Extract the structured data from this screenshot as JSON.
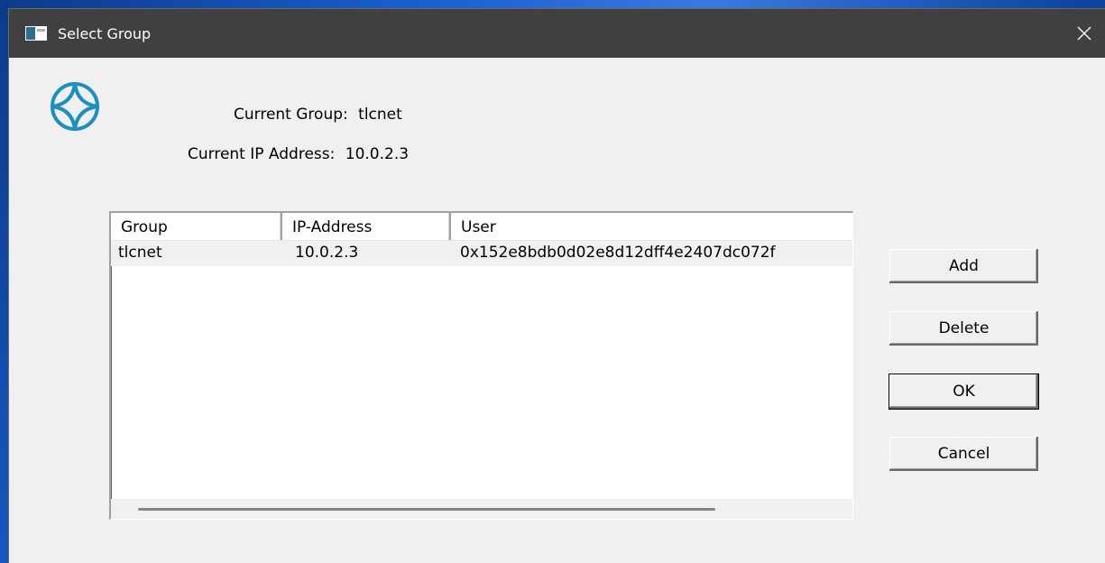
{
  "dialog": {
    "title": "Select Group",
    "current_group_label": "Current Group:",
    "current_group_value": "tlcnet",
    "current_ip_label": "Current IP Address:",
    "current_ip_value": "10.0.2.3"
  },
  "table": {
    "columns": [
      "Group",
      "IP-Address",
      "User"
    ],
    "rows": [
      {
        "group": "tlcnet",
        "ip": "10.0.2.3",
        "user": "0x152e8bdb0d02e8d12dff4e2407dc072f"
      }
    ]
  },
  "buttons": {
    "add": "Add",
    "delete": "Delete",
    "ok": "OK",
    "cancel": "Cancel"
  },
  "icons": {
    "app": "window-icon",
    "logo": "circle-diamond-logo-icon",
    "close": "close-icon"
  },
  "colors": {
    "titlebar": "#404040",
    "dialog_bg": "#f0f0f0",
    "logo": "#1a8fc0"
  }
}
